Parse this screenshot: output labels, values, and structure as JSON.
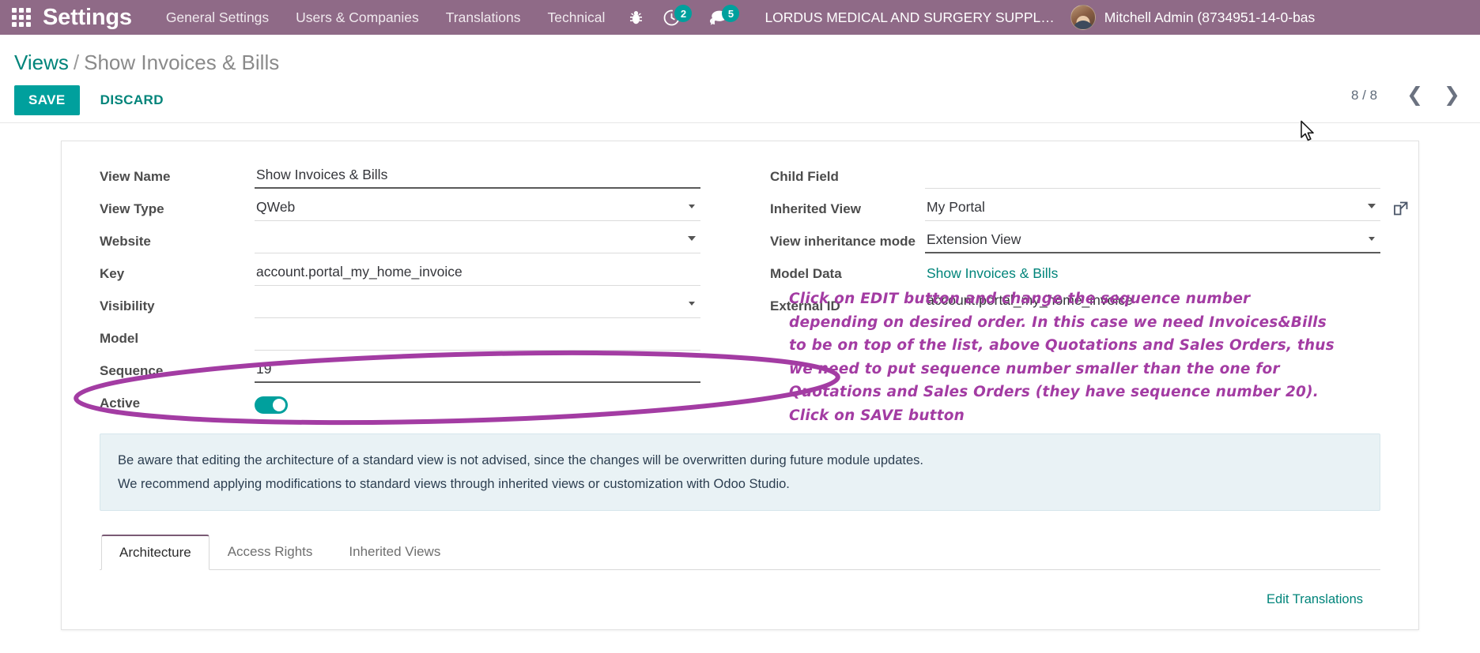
{
  "navbar": {
    "apps_icon": "apps-grid-icon",
    "brand": "Settings",
    "menu_items": [
      {
        "label": "General Settings"
      },
      {
        "label": "Users & Companies"
      },
      {
        "label": "Translations"
      },
      {
        "label": "Technical"
      }
    ],
    "debug_icon": "bug-icon",
    "activities": {
      "icon": "clock-icon",
      "count": "2"
    },
    "messages": {
      "icon": "chat-bubble-icon",
      "count": "5"
    },
    "company": "LORDUS MEDICAL AND SURGERY SUPPL…",
    "user": "Mitchell Admin (8734951-14-0-bas",
    "avatar_icon": "user-avatar"
  },
  "control_panel": {
    "breadcrumb_root": "Views",
    "breadcrumb_separator": "/",
    "breadcrumb_current": "Show Invoices & Bills",
    "save_label": "SAVE",
    "discard_label": "DISCARD",
    "pager_count": "8 / 8",
    "prev_icon": "chevron-left-icon",
    "next_icon": "chevron-right-icon"
  },
  "form": {
    "left": {
      "view_name": {
        "label": "View Name",
        "value": "Show Invoices & Bills"
      },
      "view_type": {
        "label": "View Type",
        "value": "QWeb"
      },
      "website": {
        "label": "Website",
        "value": ""
      },
      "key": {
        "label": "Key",
        "value": "account.portal_my_home_invoice"
      },
      "visibility": {
        "label": "Visibility",
        "value": ""
      },
      "model": {
        "label": "Model",
        "value": ""
      },
      "sequence": {
        "label": "Sequence",
        "value": "19"
      },
      "active": {
        "label": "Active",
        "state": "on"
      }
    },
    "right": {
      "child_field": {
        "label": "Child Field",
        "value": ""
      },
      "inherited_view": {
        "label": "Inherited View",
        "value": "My Portal",
        "external_icon": "external-link-icon"
      },
      "inheritance_mode": {
        "label": "View inheritance mode",
        "value": "Extension View"
      },
      "model_data": {
        "label": "Model Data",
        "value": "Show Invoices & Bills"
      },
      "external_id": {
        "label": "External ID",
        "value": "account.portal_my_home_invoice"
      }
    }
  },
  "annotation": {
    "note": "Click on EDIT button and change the sequence number depending on desired order. In this case we need Invoices&Bills to be on top of the list, above Quotations and Sales Orders, thus we need to put sequence number smaller than the one for Quotations and Sales Orders (they have sequence number 20). Click on SAVE button",
    "highlight_color": "#a33ca3",
    "ellipse_target": "sequence-and-active-fields"
  },
  "alert": {
    "line1": "Be aware that editing the architecture of a standard view is not advised, since the changes will be overwritten during future module updates.",
    "line2": "We recommend applying modifications to standard views through inherited views or customization with Odoo Studio."
  },
  "tabs": {
    "items": [
      {
        "label": "Architecture",
        "active": true
      },
      {
        "label": "Access Rights",
        "active": false
      },
      {
        "label": "Inherited Views",
        "active": false
      }
    ],
    "edit_translations": "Edit Translations"
  },
  "colors": {
    "navbar_bg": "#8f6a87",
    "accent_teal": "#00a09d",
    "link_teal": "#00847a",
    "annotation_purple": "#a33ca3",
    "alert_bg": "#e9f2f5"
  }
}
